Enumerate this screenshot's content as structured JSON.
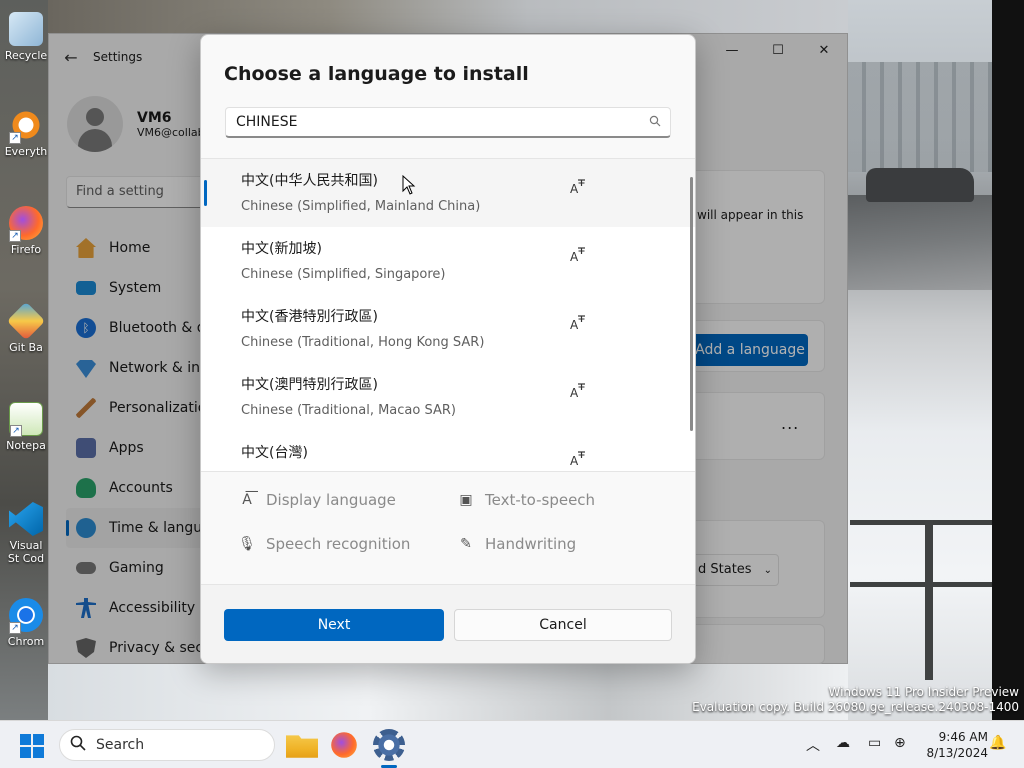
{
  "desktop": {
    "icons": [
      {
        "label": "Recycle",
        "icon": "recycle-bin-icon"
      },
      {
        "label": "Everyth",
        "icon": "everything-icon"
      },
      {
        "label": "Firefo",
        "icon": "firefox-icon"
      },
      {
        "label": "Git Ba",
        "icon": "git-bash-icon"
      },
      {
        "label": "Notepa",
        "icon": "notepad-icon"
      },
      {
        "label": "Visual St Cod",
        "icon": "vscode-icon"
      },
      {
        "label": "Chrom",
        "icon": "chrome-icon"
      }
    ],
    "watermark": {
      "line1": "Windows 11 Pro Insider Preview",
      "line2": "Evaluation copy. Build 26080.ge_release.240308-1400"
    }
  },
  "settings": {
    "title": "Settings",
    "user": {
      "name": "VM6",
      "email": "VM6@collab"
    },
    "find_placeholder": "Find a setting",
    "nav": [
      {
        "label": "Home",
        "icon": "home-icon",
        "color": "#e8a33c"
      },
      {
        "label": "System",
        "icon": "system-icon",
        "color": "#1a8ad4"
      },
      {
        "label": "Bluetooth & de",
        "icon": "bluetooth-icon",
        "color": "#1a6fd4"
      },
      {
        "label": "Network & inte",
        "icon": "network-icon",
        "color": "#3b8fd9"
      },
      {
        "label": "Personalization",
        "icon": "brush-icon",
        "color": "#c07a3a"
      },
      {
        "label": "Apps",
        "icon": "apps-icon",
        "color": "#5b6fa8"
      },
      {
        "label": "Accounts",
        "icon": "accounts-icon",
        "color": "#2aa36a"
      },
      {
        "label": "Time & langua",
        "icon": "globe-clock-icon",
        "color": "#2d8bd0",
        "active": true
      },
      {
        "label": "Gaming",
        "icon": "gaming-icon",
        "color": "#777777"
      },
      {
        "label": "Accessibility",
        "icon": "accessibility-icon",
        "color": "#1d6fc9"
      },
      {
        "label": "Privacy & secu",
        "icon": "shield-icon",
        "color": "#666666"
      }
    ],
    "side_text": "will appear in this",
    "add_language_label": "Add a language",
    "more_label": "...",
    "region_value": "d States"
  },
  "dialog": {
    "title": "Choose a language to install",
    "search_value": "CHINESE",
    "languages": [
      {
        "native": "中文(中华人民共和国)",
        "english": "Chinese (Simplified, Mainland China)",
        "selected": true
      },
      {
        "native": "中文(新加坡)",
        "english": "Chinese (Simplified, Singapore)"
      },
      {
        "native": "中文(香港特別行政區)",
        "english": "Chinese (Traditional, Hong Kong SAR)"
      },
      {
        "native": "中文(澳門特別行政區)",
        "english": "Chinese (Traditional, Macao SAR)"
      },
      {
        "native": "中文(台灣)",
        "english": ""
      }
    ],
    "features": {
      "display_language": "Display language",
      "text_to_speech": "Text-to-speech",
      "speech_recognition": "Speech recognition",
      "handwriting": "Handwriting"
    },
    "next_label": "Next",
    "cancel_label": "Cancel"
  },
  "taskbar": {
    "search_label": "Search",
    "time": "9:46 AM",
    "date": "8/13/2024",
    "accent": "#0067c0"
  }
}
